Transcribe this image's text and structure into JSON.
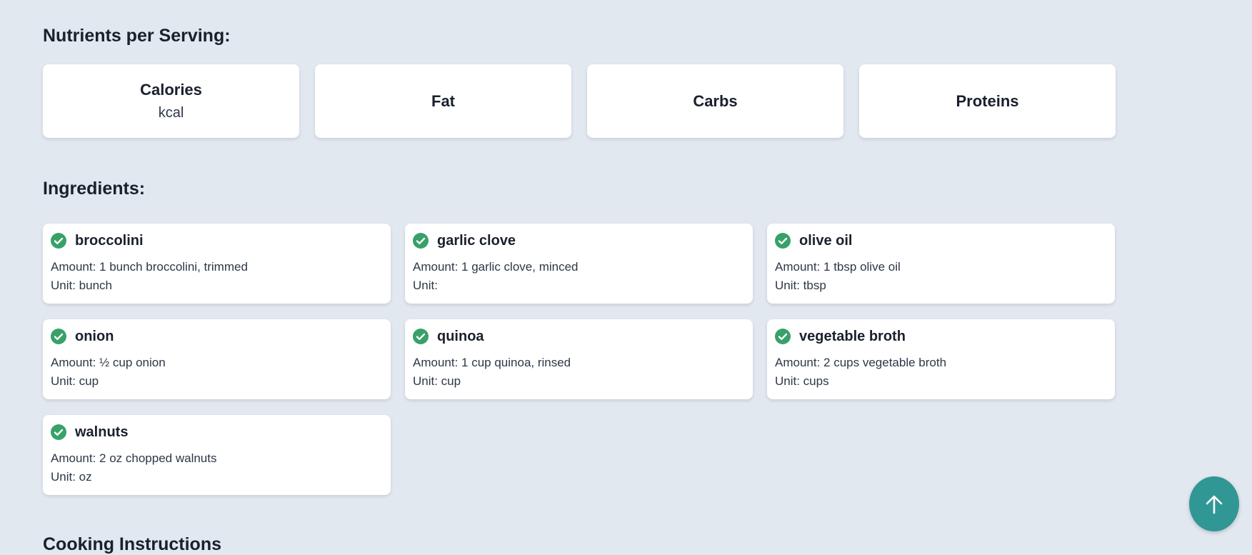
{
  "nutrients": {
    "title": "Nutrients per Serving:",
    "items": [
      {
        "name": "Calories",
        "unit": "kcal"
      },
      {
        "name": "Fat",
        "unit": ""
      },
      {
        "name": "Carbs",
        "unit": ""
      },
      {
        "name": "Proteins",
        "unit": ""
      }
    ]
  },
  "ingredients": {
    "title": "Ingredients:",
    "items": [
      {
        "name": "broccolini",
        "amount": "Amount: 1 bunch broccolini, trimmed",
        "unit": "Unit: bunch"
      },
      {
        "name": "garlic clove",
        "amount": "Amount: 1 garlic clove, minced",
        "unit": "Unit:"
      },
      {
        "name": "olive oil",
        "amount": "Amount: 1 tbsp olive oil",
        "unit": "Unit: tbsp"
      },
      {
        "name": "onion",
        "amount": "Amount: ½ cup onion",
        "unit": "Unit: cup"
      },
      {
        "name": "quinoa",
        "amount": "Amount: 1 cup quinoa, rinsed",
        "unit": "Unit: cup"
      },
      {
        "name": "vegetable broth",
        "amount": "Amount: 2 cups vegetable broth",
        "unit": "Unit: cups"
      },
      {
        "name": "walnuts",
        "amount": "Amount: 2 oz chopped walnuts",
        "unit": "Unit: oz"
      }
    ]
  },
  "instructions": {
    "title": "Cooking Instructions"
  },
  "scroll_top": {
    "icon": "arrow-up-icon"
  },
  "colors": {
    "background": "#e2e8f0",
    "check": "#38a169",
    "scroll_button": "#319795"
  }
}
